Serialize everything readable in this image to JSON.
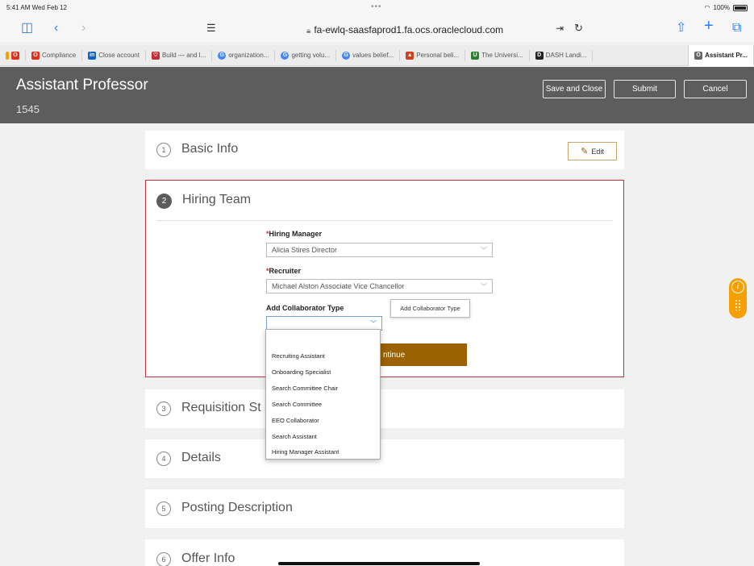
{
  "status": {
    "time": "5:41 AM  Wed Feb 12",
    "battery": "100%"
  },
  "browser": {
    "url": "fa-ewlq-saasfaprod1.fa.ocs.oraclecloud.com"
  },
  "bookmarks": [
    {
      "label": "",
      "color": "#e0301e",
      "glyph": "O"
    },
    {
      "label": "Compliance",
      "color": "#e0301e",
      "glyph": "O"
    },
    {
      "label": "Close account",
      "color": "#0a66c2",
      "glyph": "in"
    },
    {
      "label": "Build — and l...",
      "color": "#c0303a",
      "glyph": "♡"
    },
    {
      "label": "organization...",
      "color": "#4285f4",
      "glyph": "G"
    },
    {
      "label": "getting volu...",
      "color": "#4285f4",
      "glyph": "G"
    },
    {
      "label": "values belief...",
      "color": "#4285f4",
      "glyph": "G"
    },
    {
      "label": "Personal beli...",
      "color": "#d04020",
      "glyph": "▲"
    },
    {
      "label": "The Universi...",
      "color": "#2e7d32",
      "glyph": "U"
    },
    {
      "label": "DASH Landi...",
      "color": "#222222",
      "glyph": "D"
    },
    {
      "label": "Assistant Pr...",
      "color": "#666666",
      "glyph": "O"
    }
  ],
  "header": {
    "title": "Assistant Professor",
    "subtitle": "1545",
    "save_label": "Save and Close",
    "submit_label": "Submit",
    "cancel_label": "Cancel"
  },
  "sections": {
    "basic": {
      "num": "1",
      "title": "Basic Info",
      "edit_label": "Edit"
    },
    "hiring": {
      "num": "2",
      "title": "Hiring Team"
    },
    "requisition": {
      "num": "3",
      "title": "Requisition St"
    },
    "details": {
      "num": "4",
      "title": "Details"
    },
    "posting": {
      "num": "5",
      "title": "Posting Description"
    },
    "offer": {
      "num": "6",
      "title": "Offer Info"
    }
  },
  "form": {
    "manager_label": "Hiring Manager",
    "manager_value": "Alicia Stires Director",
    "recruiter_label": "Recruiter",
    "recruiter_value": "Michael Alston Associate Vice Chancellor",
    "collab_label": "Add Collaborator Type",
    "collab_value": "",
    "tooltip": "Add Collaborator Type",
    "continue_label": "ntinue"
  },
  "dropdown": {
    "options": [
      "Recruiting Assistant",
      "Onboarding Specialist",
      "Search Committee Chair",
      "Search Committee",
      "EEO Collaborator",
      "Search Assistant",
      "Hiring Manager Assistant"
    ]
  }
}
